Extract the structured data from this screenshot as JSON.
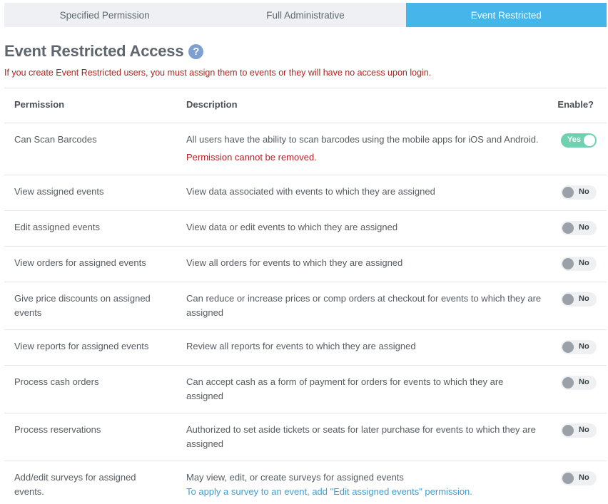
{
  "tabs": [
    {
      "label": "Specified Permission",
      "active": false
    },
    {
      "label": "Full Administrative",
      "active": false
    },
    {
      "label": "Event Restricted",
      "active": true
    }
  ],
  "heading": {
    "title": "Event Restricted Access",
    "help_icon": "?"
  },
  "warning": "If you create Event Restricted users, you must assign them to events or they will have no access upon login.",
  "table": {
    "headers": {
      "permission": "Permission",
      "description": "Description",
      "enable": "Enable?"
    },
    "rows": [
      {
        "permission": "Can Scan Barcodes",
        "description": "All users have the ability to scan barcodes using the mobile apps for iOS and Android.",
        "note": "Permission cannot be removed.",
        "enabled": true,
        "toggle_label": "Yes"
      },
      {
        "permission": "View assigned events",
        "description": "View data associated with events to which they are assigned",
        "enabled": false,
        "toggle_label": "No"
      },
      {
        "permission": "Edit assigned events",
        "description": "View data or edit events to which they are assigned",
        "enabled": false,
        "toggle_label": "No"
      },
      {
        "permission": "View orders for assigned events",
        "description": "View all orders for events to which they are assigned",
        "enabled": false,
        "toggle_label": "No"
      },
      {
        "permission": "Give price discounts on assigned events",
        "description": "Can reduce or increase prices or comp orders at checkout for events to which they are assigned",
        "enabled": false,
        "toggle_label": "No"
      },
      {
        "permission": "View reports for assigned events",
        "description": "Review all reports for events to which they are assigned",
        "enabled": false,
        "toggle_label": "No"
      },
      {
        "permission": "Process cash orders",
        "description": "Can accept cash as a form of payment for orders for events to which they are assigned",
        "enabled": false,
        "toggle_label": "No"
      },
      {
        "permission": "Process reservations",
        "description": "Authorized to set aside tickets or seats for later purchase for events to which they are assigned",
        "enabled": false,
        "toggle_label": "No"
      },
      {
        "permission": "Add/edit surveys for assigned events.",
        "description": "May view, edit, or create surveys for assigned events",
        "link": "To apply a survey to an event, add \"Edit assigned events\" permission.",
        "enabled": false,
        "toggle_label": "No"
      }
    ]
  },
  "colors": {
    "accent": "#45b5ea",
    "toggle_on": "#6ed2b1",
    "warning": "#b32222",
    "link": "#3a9fd6"
  }
}
